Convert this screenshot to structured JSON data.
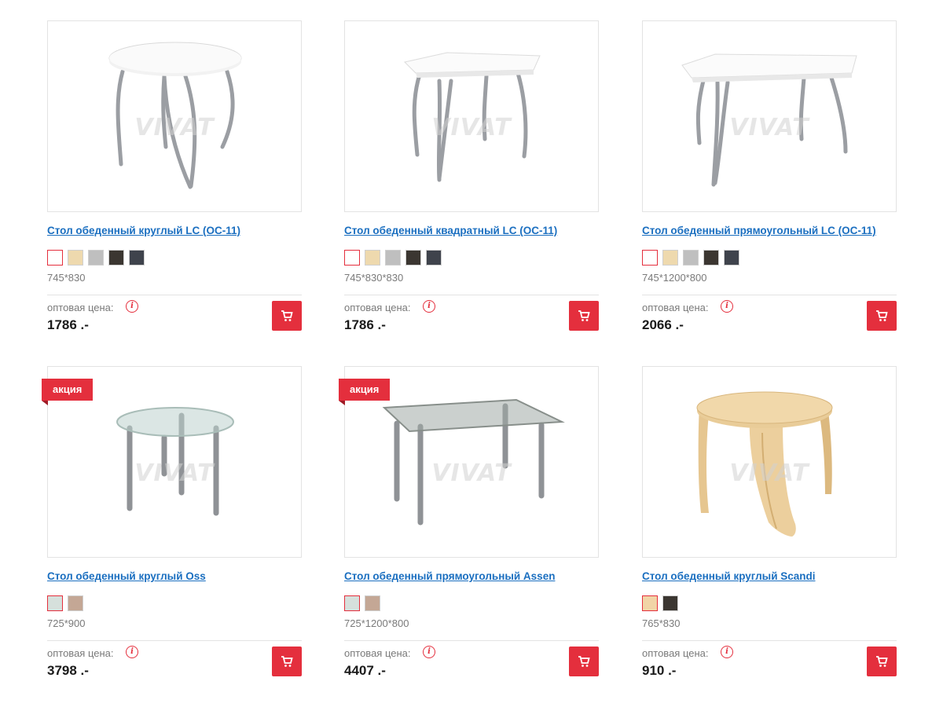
{
  "products": [
    {
      "title": "Стол обеденный круглый LC (ОС-11)",
      "dims": "745*830",
      "price_label": "оптовая цена:",
      "price": "1786 .-",
      "swatches": [
        "#ffffff",
        "#eed9ae",
        "#bfbfbf",
        "#3b3631",
        "#3f434c"
      ],
      "badge": ""
    },
    {
      "title": "Стол обеденный квадратный LC (ОС-11)",
      "dims": "745*830*830",
      "price_label": "оптовая цена:",
      "price": "1786 .-",
      "swatches": [
        "#ffffff",
        "#eed9ae",
        "#bfbfbf",
        "#3b3631",
        "#3f434c"
      ],
      "badge": ""
    },
    {
      "title": "Стол обеденный прямоугольный LC (ОС-11)",
      "dims": "745*1200*800",
      "price_label": "оптовая цена:",
      "price": "2066 .-",
      "swatches": [
        "#ffffff",
        "#eed9ae",
        "#bfbfbf",
        "#3b3631",
        "#3f434c"
      ],
      "badge": ""
    },
    {
      "title": "Стол обеденный круглый Oss",
      "dims": "725*900",
      "price_label": "оптовая цена:",
      "price": "3798 .-",
      "swatches": [
        "#d6e0dc",
        "#c4a795"
      ],
      "badge": "акция"
    },
    {
      "title": "Стол обеденный прямоугольный Assen",
      "dims": "725*1200*800",
      "price_label": "оптовая цена:",
      "price": "4407 .-",
      "swatches": [
        "#d6e0dc",
        "#c4a795"
      ],
      "badge": "акция"
    },
    {
      "title": "Стол обеденный круглый Scandi",
      "dims": "765*830",
      "price_label": "оптовая цена:",
      "price": "910 .-",
      "swatches": [
        "#f1d4a6",
        "#3b3631"
      ],
      "badge": ""
    }
  ],
  "watermark": "VIVAT",
  "colors": {
    "accent": "#e42f3d",
    "link": "#1b6fc0"
  },
  "icons": {
    "cart": "shopping-cart-icon",
    "info": "info-icon"
  }
}
